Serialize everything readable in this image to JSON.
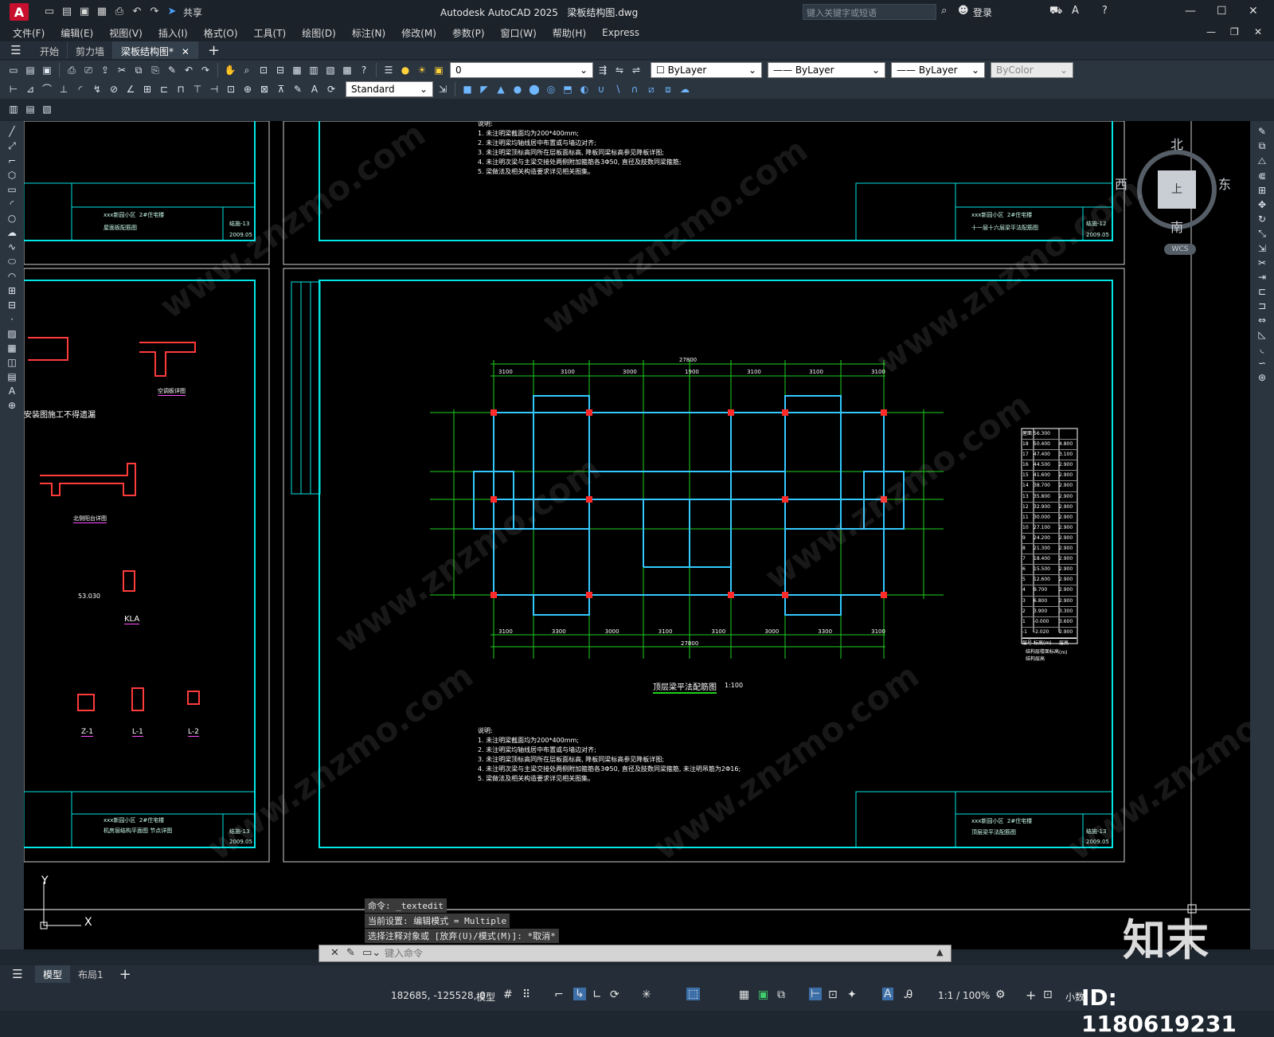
{
  "app": {
    "title": "Autodesk AutoCAD 2025",
    "filename": "梁板结构图.dwg",
    "search_placeholder": "键入关键字或短语",
    "share_label": "共享",
    "login_label": "登录"
  },
  "menu": [
    "文件(F)",
    "编辑(E)",
    "视图(V)",
    "插入(I)",
    "格式(O)",
    "工具(T)",
    "绘图(D)",
    "标注(N)",
    "修改(M)",
    "参数(P)",
    "窗口(W)",
    "帮助(H)",
    "Express"
  ],
  "doc_tabs": [
    {
      "label": "开始",
      "active": false
    },
    {
      "label": "剪力墙",
      "active": false
    },
    {
      "label": "梁板结构图*",
      "active": true
    }
  ],
  "properties": {
    "text_style": "Standard",
    "layer": "0",
    "color": "ByLayer",
    "linetype": "ByLayer",
    "lineweight": "ByLayer",
    "plotstyle": "ByColor"
  },
  "viewcube": {
    "north": "北",
    "south": "南",
    "east": "东",
    "west": "西",
    "top": "上",
    "wcs": "WCS"
  },
  "drawing": {
    "main_title": "顶层梁平法配筋图",
    "main_scale": "1:100",
    "notes_heading": "说明:",
    "notes": [
      "1. 未注明梁截面均为200*400mm;",
      "2. 未注明梁均轴线居中布置或与墙边对齐;",
      "3. 未注明梁顶标高同所在层板面标高, 降板同梁标高参见降板详图;",
      "4. 未注明次梁与主梁交接处两侧附加箍筋各3Φ50, 直径及肢数同梁箍筋, 未注明吊筋为2Φ16;",
      "5. 梁做法及相关构造要求详见相关图集。"
    ],
    "top_notes": [
      "1. 未注明梁截面均为200*400mm;",
      "2. 未注明梁均轴线居中布置或与墙边对齐;",
      "3. 未注明梁顶标高同所在层板面标高, 降板同梁标高参见降板详图;",
      "4. 未注明次梁与主梁交接处两侧附加箍筋各3Φ50, 直径及肢数同梁箍筋;",
      "5. 梁做法及相关构造要求详见相关图集。"
    ],
    "title_blocks": [
      {
        "project": "xxx新园小区",
        "building": "2#住宅楼",
        "drawing": "屋面板配筋图",
        "num": "结施-13",
        "date": "2009.05"
      },
      {
        "project": "xxx新园小区",
        "building": "2#住宅楼",
        "drawing": "十一层十六层梁平法配筋图",
        "num": "结施-12",
        "date": "2009.05"
      },
      {
        "project": "xxx新园小区",
        "building": "2#住宅楼",
        "drawing": "机房层结构平面图 节点详图",
        "num": "结施-13",
        "date": "2009.05"
      },
      {
        "project": "xxx新园小区",
        "building": "2#住宅楼",
        "drawing": "顶层梁平法配筋图",
        "num": "结施-13",
        "date": "2009.05"
      }
    ],
    "left_labels": [
      "安装图施工不得遗漏",
      "空调板详图",
      "北侧阳台详图",
      "KLA",
      "Z-1",
      "L-1",
      "L-2",
      "53.030"
    ],
    "dims_top": [
      "27800",
      "3100",
      "3100",
      "3000",
      "1900",
      "3100",
      "3100",
      "3100"
    ],
    "dims_bottom": [
      "3100",
      "3300",
      "3000",
      "3100",
      "3100",
      "3000",
      "3300",
      "3100",
      "27800"
    ],
    "floor_table": {
      "header": [
        "层号",
        "标高(m)",
        "层高(m)"
      ],
      "rows": [
        [
          "屋面",
          "56.300",
          ""
        ],
        [
          "18",
          "50.400",
          "4.800"
        ],
        [
          "17",
          "47.400",
          "3.100"
        ],
        [
          "16",
          "44.500",
          "2.900"
        ],
        [
          "15",
          "41.600",
          "2.900"
        ],
        [
          "14",
          "38.700",
          "2.900"
        ],
        [
          "13",
          "35.800",
          "2.900"
        ],
        [
          "12",
          "32.900",
          "2.900"
        ],
        [
          "11",
          "30.000",
          "2.900"
        ],
        [
          "10",
          "27.100",
          "2.900"
        ],
        [
          "9",
          "24.200",
          "2.900"
        ],
        [
          "8",
          "21.300",
          "2.900"
        ],
        [
          "7",
          "18.400",
          "2.900"
        ],
        [
          "6",
          "15.500",
          "2.900"
        ],
        [
          "5",
          "12.600",
          "2.900"
        ],
        [
          "4",
          "9.700",
          "2.900"
        ],
        [
          "3",
          "6.800",
          "2.900"
        ],
        [
          "2",
          "3.900",
          "3.300"
        ],
        [
          "1",
          "-0.000",
          "3.600"
        ],
        [
          "-1",
          "-2.020",
          "2.900"
        ]
      ],
      "caption1": "结构层楼面标高",
      "caption2": "结构层高"
    }
  },
  "command": {
    "history": [
      "命令: _textedit",
      "当前设置: 编辑模式 = Multiple",
      "选择注释对象或 [放弃(U)/模式(M)]: *取消*"
    ],
    "placeholder": "键入命令"
  },
  "layout_tabs": [
    "模型",
    "布局1"
  ],
  "status": {
    "coords": "182685, -125528, 0",
    "model": "模型",
    "scale": "1:1 / 100%",
    "units": "小数"
  },
  "watermark": {
    "brand": "知末",
    "id_text": "ID: 1180619231",
    "site": "www.znzmo.com"
  },
  "ucs": {
    "x": "X",
    "y": "Y"
  }
}
